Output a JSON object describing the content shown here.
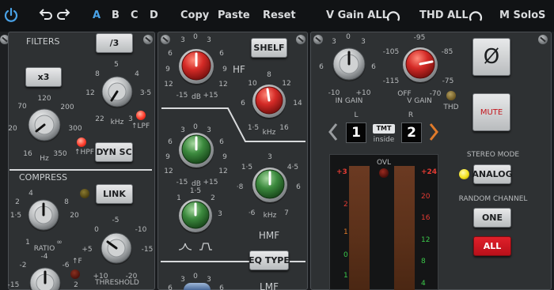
{
  "topbar": {
    "slots": [
      "A",
      "B",
      "C",
      "D"
    ],
    "copy": "Copy",
    "paste": "Paste",
    "reset": "Reset",
    "vgain": "V Gain ALL",
    "thd": "THD ALL",
    "msolo": "M Solo",
    "s": "S"
  },
  "filters": {
    "title": "FILTERS",
    "div3": "/3",
    "x3": "x3",
    "hpf_scale": [
      "70",
      "120",
      "200",
      "20",
      "300",
      "16",
      "350"
    ],
    "hpf_unit": "Hz",
    "hpf_label": "HPF",
    "lpf_scale": [
      "8",
      "5",
      "4",
      "12",
      "3·5",
      "22",
      "3"
    ],
    "lpf_unit": "kHz",
    "lpf_label": "LPF",
    "dynsc": "DYN SC"
  },
  "compress": {
    "title": "COMPRESS",
    "link": "LINK",
    "ratio_scale": [
      "4",
      "2",
      "8",
      "1·5",
      "20",
      "1",
      "∞"
    ],
    "ratio_label": "RATIO",
    "threshold_scale": [
      "-5",
      "0",
      "-10",
      "+5",
      "-15",
      "+10",
      "-20"
    ],
    "threshold_label": "THRESHOLD",
    "fast_label": "F",
    "bottom_scale": [
      "-4",
      "-2",
      "-6",
      "-15",
      "2"
    ]
  },
  "eq": {
    "hf_label": "HF",
    "hf_gain_scale": [
      "3",
      "0",
      "3",
      "6",
      "6",
      "9",
      "9",
      "12",
      "12",
      "-15",
      "+15"
    ],
    "hf_unit": "dB",
    "shelf": "SHELF",
    "hf_freq_scale": [
      "10",
      "8",
      "12",
      "6",
      "14",
      "1·5",
      "16"
    ],
    "hf_freq_unit": "kHz",
    "hmf_gain_scale": [
      "3",
      "0",
      "3",
      "6",
      "6",
      "9",
      "9",
      "12",
      "12",
      "-15",
      "+15"
    ],
    "hmf_gain_unit": "dB",
    "hmf_q_scale": [
      "1·5",
      "1",
      "2",
      "3"
    ],
    "hmf_freq_scale": [
      "3",
      "1·5",
      "4·5",
      "·8",
      "6",
      "·6",
      "7"
    ],
    "hmf_freq_unit": "kHz",
    "hmf_label": "HMF",
    "eqtype": "EQ TYPE",
    "lmf_label": "LMF",
    "lmf_scale": [
      "3",
      "0",
      "3",
      "6",
      "6"
    ]
  },
  "output": {
    "in_gain_scale": [
      "3",
      "0",
      "3",
      "6",
      "6",
      "-10",
      "+10"
    ],
    "in_gain_label": "IN GAIN",
    "v_gain_scale": [
      "-95",
      "-105",
      "-85",
      "-115",
      "-75",
      "OFF",
      "-70"
    ],
    "v_gain_label": "V GAIN",
    "thd_label": "THD",
    "phase": "Ø",
    "mute": "MUTE",
    "ch_l": "L",
    "ch_r": "R",
    "ch_left_value": "1",
    "ch_right_value": "2",
    "tmt": "TMT",
    "tmt_sub": "inside",
    "ovl": "OVL",
    "meter_left_scale": [
      "+3",
      "2",
      "1",
      "0",
      "1"
    ],
    "meter_right_scale": [
      "+24",
      "20",
      "16",
      "12",
      "8",
      "4"
    ],
    "stereo_mode_title": "STEREO MODE",
    "stereo_mode_value": "ANALOG",
    "random_channel_title": "RANDOM CHANNEL",
    "random_one": "ONE",
    "random_all": "ALL"
  },
  "colors": {
    "accent": "#4aa3e8",
    "knob_red": "#d42a26",
    "knob_green": "#3c8a3e",
    "led_red": "#ff3a2a",
    "led_yellow": "#f2e21a",
    "panel": "#2e3133",
    "meter_bar": "#5a3019",
    "arrow_orange": "#e07a2a"
  }
}
